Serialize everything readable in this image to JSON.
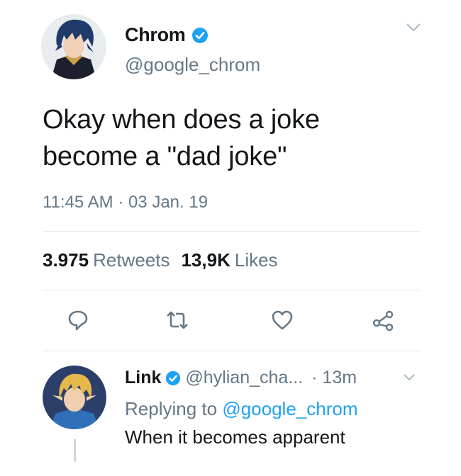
{
  "tweet": {
    "display_name": "Chrom",
    "handle": "@google_chrom",
    "text_line1": "Okay when does a joke",
    "text_line2": "become a \"dad joke\"",
    "timestamp": "11:45 AM · 03 Jan. 19",
    "retweets_count": "3.975",
    "retweets_label": "Retweets",
    "likes_count": "13,9K",
    "likes_label": "Likes"
  },
  "reply": {
    "display_name": "Link",
    "handle": "@hylian_cha...",
    "time": "· 13m",
    "replying_prefix": "Replying to",
    "replying_handle": "@google_chrom",
    "text": "When it becomes apparent"
  },
  "icons": {
    "verified": "verified-badge-icon",
    "chevron": "chevron-down-icon",
    "reply": "reply-icon",
    "retweet": "retweet-icon",
    "like": "heart-icon",
    "share": "share-icon"
  },
  "colors": {
    "accent": "#1da1f2",
    "secondary_text": "#657786",
    "primary_text": "#14171a",
    "divider": "#e1e8ed"
  }
}
